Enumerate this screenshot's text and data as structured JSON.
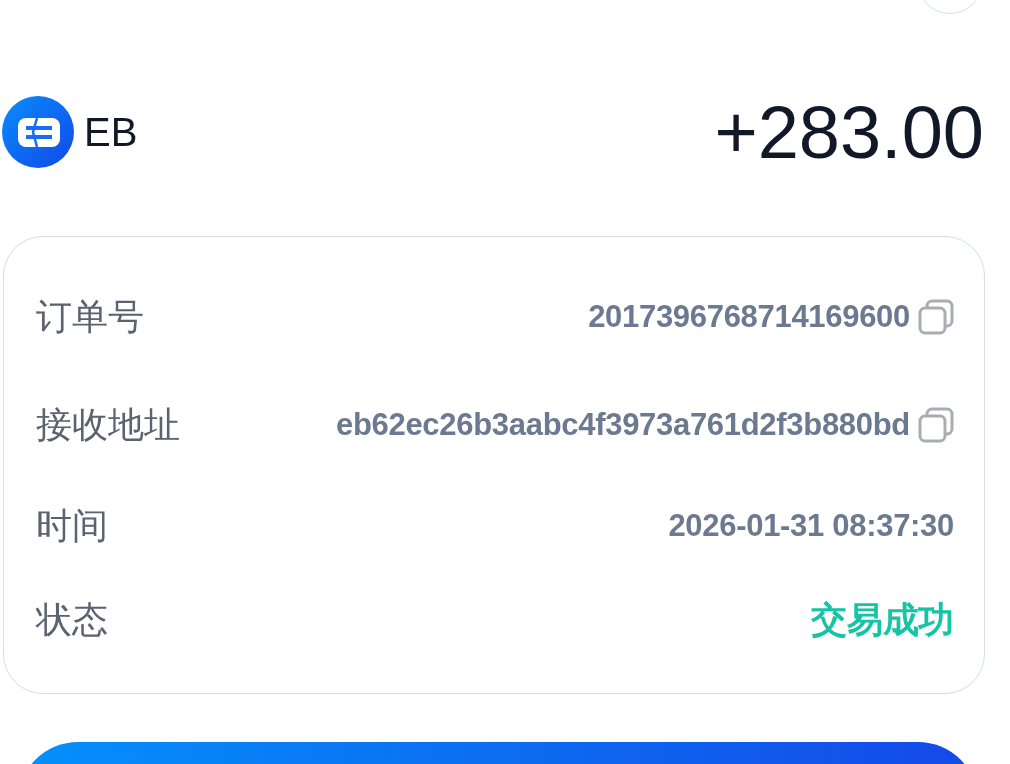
{
  "asset": {
    "symbol": "EB",
    "amount": "+283.00"
  },
  "details": [
    {
      "kind": "copyable",
      "label": "订单号",
      "value": "2017396768714169600"
    },
    {
      "kind": "copyable",
      "label": "接收地址",
      "value": "eb62ec26b3aabc4f3973a761d2f3b880bd"
    },
    {
      "kind": "plain",
      "label": "时间",
      "value": "2026-01-31 08:37:30"
    },
    {
      "kind": "status",
      "label": "状态",
      "value": "交易成功"
    }
  ]
}
